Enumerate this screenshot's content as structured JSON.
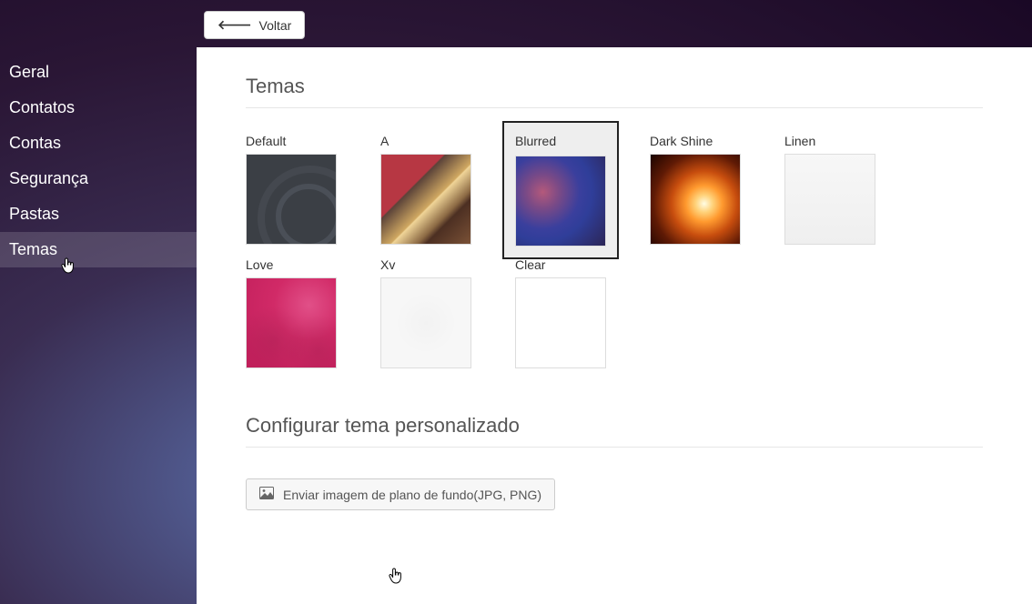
{
  "back_button": {
    "label": "Voltar"
  },
  "sidebar": {
    "items": [
      {
        "label": "Geral"
      },
      {
        "label": "Contatos"
      },
      {
        "label": "Contas"
      },
      {
        "label": "Segurança"
      },
      {
        "label": "Pastas"
      },
      {
        "label": "Temas"
      }
    ],
    "active_index": 5
  },
  "main": {
    "themes_title": "Temas",
    "custom_title": "Configurar tema personalizado",
    "upload_label": "Enviar imagem de plano de fundo(JPG, PNG)",
    "themes": [
      {
        "label": "Default",
        "swatch": "sw-default",
        "selected": false
      },
      {
        "label": "A",
        "swatch": "sw-a",
        "selected": false
      },
      {
        "label": "Blurred",
        "swatch": "sw-blurred",
        "selected": true
      },
      {
        "label": "Dark Shine",
        "swatch": "sw-darkshine",
        "selected": false
      },
      {
        "label": "Linen",
        "swatch": "sw-linen",
        "selected": false
      },
      {
        "label": "Love",
        "swatch": "sw-love",
        "selected": false
      },
      {
        "label": "Xv",
        "swatch": "sw-xv",
        "selected": false
      },
      {
        "label": "Clear",
        "swatch": "sw-clear",
        "selected": false
      }
    ]
  }
}
